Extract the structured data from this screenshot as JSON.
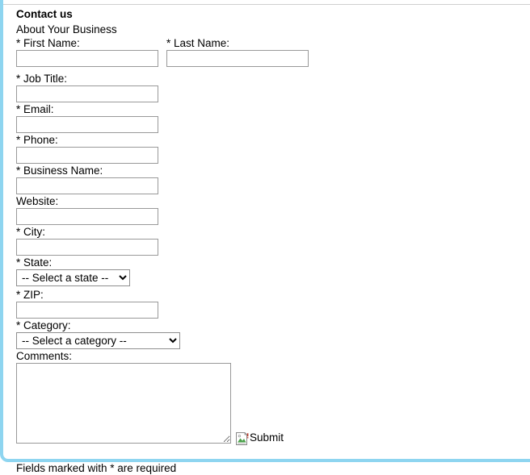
{
  "page": {
    "top_cutoff_text": "",
    "heading": "Contact us",
    "subheading": "About Your Business",
    "footnote": "Fields marked with * are required",
    "accent_border_color": "#8ed5f0",
    "input_border_color": "#999999",
    "text_color": "#000000",
    "background_color": "#ffffff"
  },
  "form": {
    "fields": {
      "first_name": {
        "label": "* First Name:",
        "value": "",
        "placeholder": "",
        "required": true
      },
      "last_name": {
        "label": "* Last Name:",
        "value": "",
        "placeholder": "",
        "required": true
      },
      "job_title": {
        "label": "* Job Title:",
        "value": "",
        "placeholder": "",
        "required": true
      },
      "email": {
        "label": "* Email:",
        "value": "",
        "placeholder": "",
        "required": true
      },
      "phone": {
        "label": "* Phone:",
        "value": "",
        "placeholder": "",
        "required": true
      },
      "business_name": {
        "label": "* Business Name:",
        "value": "",
        "placeholder": "",
        "required": true
      },
      "website": {
        "label": "Website:",
        "value": "",
        "placeholder": "",
        "required": false
      },
      "city": {
        "label": "* City:",
        "value": "",
        "placeholder": "",
        "required": true
      },
      "state": {
        "label": "* State:",
        "selected": "-- Select a state --",
        "options": [
          "-- Select a state --"
        ],
        "required": true
      },
      "zip": {
        "label": "* ZIP:",
        "value": "",
        "placeholder": "",
        "required": true
      },
      "category": {
        "label": "* Category:",
        "selected": "-- Select a category --",
        "options": [
          "-- Select a category --"
        ],
        "required": true
      },
      "comments": {
        "label": "Comments:",
        "value": "",
        "placeholder": "",
        "required": false
      }
    },
    "submit": {
      "label": "Submit",
      "icon": "broken-image-icon"
    }
  }
}
